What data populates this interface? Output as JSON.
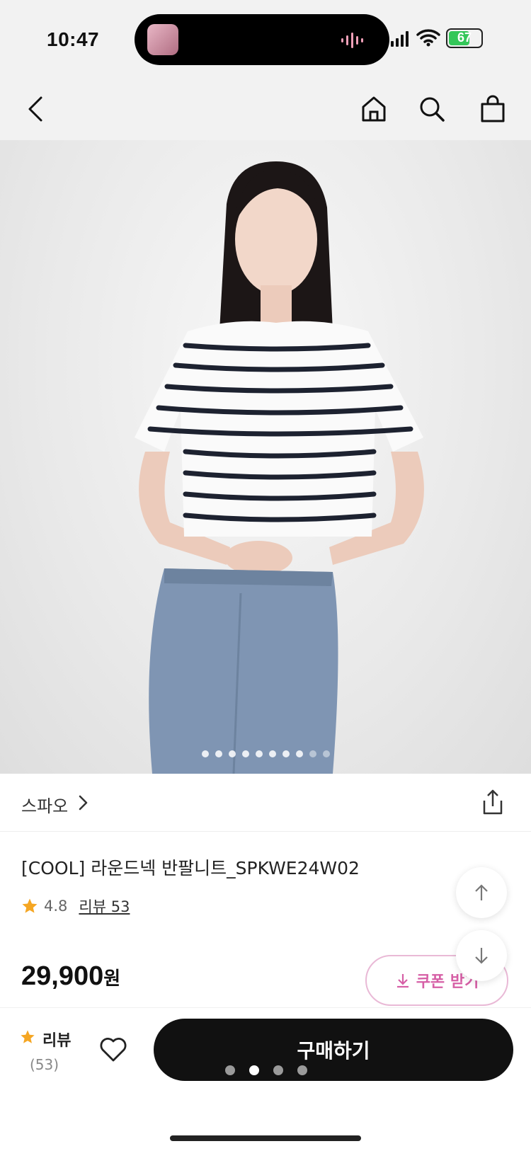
{
  "status_bar": {
    "time": "10:47",
    "battery": "67",
    "battery_level": 0.67
  },
  "header": {
    "back_icon": "chevron-left-icon",
    "home_icon": "home-icon",
    "search_icon": "search-icon",
    "cart_icon": "shopping-bag-icon"
  },
  "gallery": {
    "image_count": 10,
    "current_index": 3
  },
  "brand": {
    "name": "스파오"
  },
  "product": {
    "title": "[COOL] 라운드넥 반팔니트_SPKWE24W02",
    "rating": "4.8",
    "review_label": "리뷰 53",
    "price": "29,900",
    "price_unit": "원"
  },
  "coupon": {
    "label": "쿠폰 받기"
  },
  "bottom_bar": {
    "review_label": "리뷰",
    "review_count": "(53)",
    "buy_label": "구매하기"
  },
  "pager": {
    "count": 4,
    "active": 1
  },
  "colors": {
    "accent_pink": "#d65fa6",
    "star": "#f5a623",
    "buy_button": "#111111"
  }
}
